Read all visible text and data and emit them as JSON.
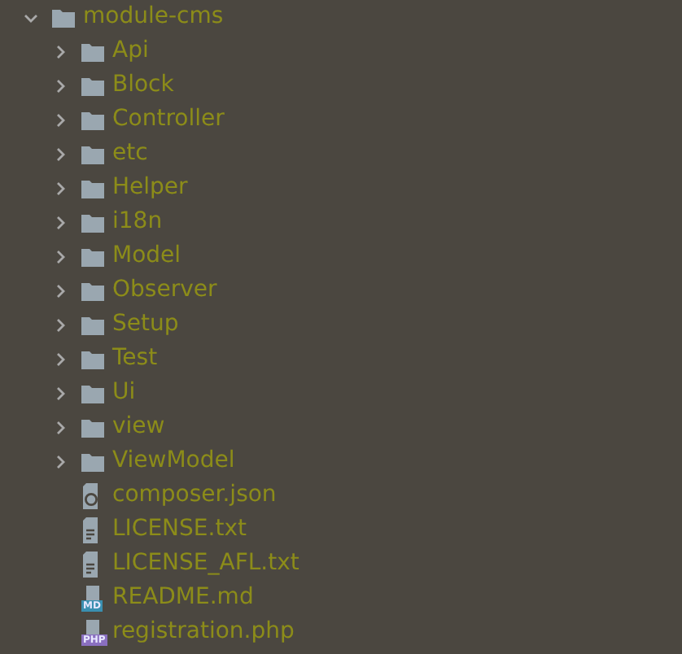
{
  "tree": {
    "label": "module-cms",
    "kind": "folder",
    "expanded": true,
    "children": [
      {
        "label": "Api",
        "kind": "folder",
        "expanded": false
      },
      {
        "label": "Block",
        "kind": "folder",
        "expanded": false
      },
      {
        "label": "Controller",
        "kind": "folder",
        "expanded": false
      },
      {
        "label": "etc",
        "kind": "folder",
        "expanded": false
      },
      {
        "label": "Helper",
        "kind": "folder",
        "expanded": false
      },
      {
        "label": "i18n",
        "kind": "folder",
        "expanded": false
      },
      {
        "label": "Model",
        "kind": "folder",
        "expanded": false
      },
      {
        "label": "Observer",
        "kind": "folder",
        "expanded": false
      },
      {
        "label": "Setup",
        "kind": "folder",
        "expanded": false
      },
      {
        "label": "Test",
        "kind": "folder",
        "expanded": false
      },
      {
        "label": "Ui",
        "kind": "folder",
        "expanded": false
      },
      {
        "label": "view",
        "kind": "folder",
        "expanded": false
      },
      {
        "label": "ViewModel",
        "kind": "folder",
        "expanded": false
      },
      {
        "label": "composer.json",
        "kind": "json"
      },
      {
        "label": "LICENSE.txt",
        "kind": "text"
      },
      {
        "label": "LICENSE_AFL.txt",
        "kind": "text"
      },
      {
        "label": "README.md",
        "kind": "markdown",
        "badge": "MD"
      },
      {
        "label": "registration.php",
        "kind": "php",
        "badge": "PHP"
      }
    ]
  }
}
